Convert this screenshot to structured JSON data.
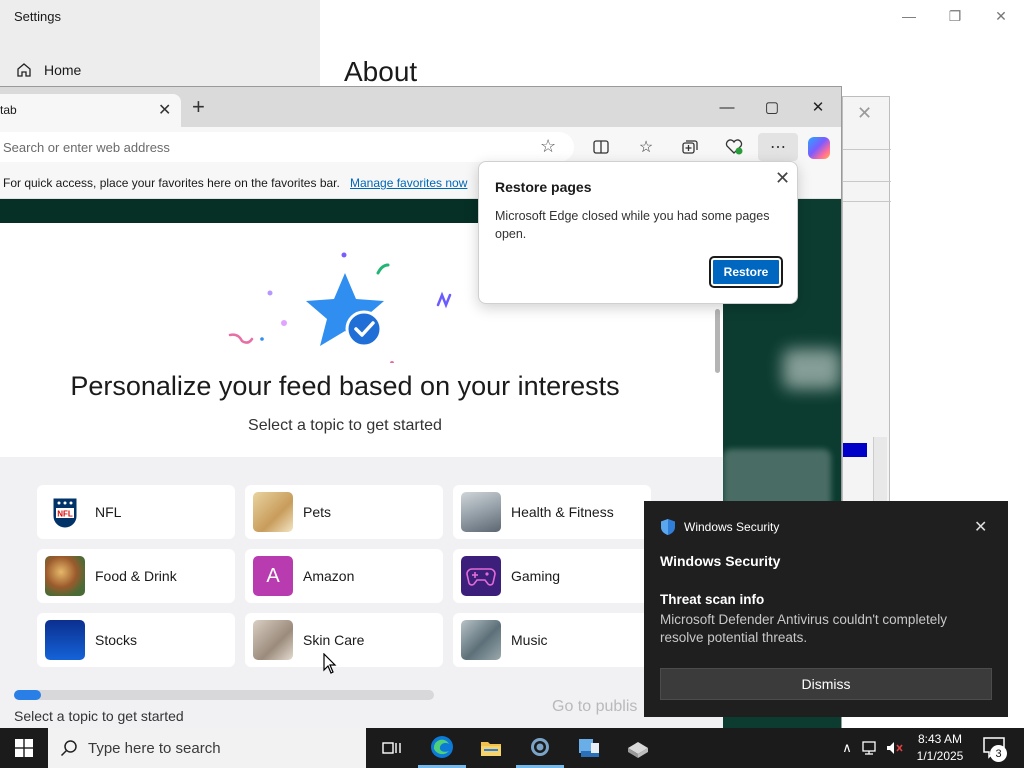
{
  "settings": {
    "title": "Settings",
    "home": "Home",
    "page_title": "About"
  },
  "edge": {
    "tab_title": "tab",
    "address_placeholder": "Search or enter web address",
    "favorites_message": "For quick access, place your favorites here on the favorites bar.",
    "favorites_link": "Manage favorites now"
  },
  "feed": {
    "headline": "Personalize your feed based on your interests",
    "subheadline": "Select a topic to get started",
    "topics": [
      "NFL",
      "Pets",
      "Health & Fitness",
      "Food & Drink",
      "Amazon",
      "Gaming",
      "Stocks",
      "Skin Care",
      "Music"
    ],
    "amazon_letter": "A",
    "progress_fraction": 0.065,
    "footer_prompt": "Select a topic to get started",
    "go_to_publisher": "Go to publis"
  },
  "restore_popup": {
    "title": "Restore pages",
    "body": "Microsoft Edge closed while you had some pages open.",
    "button": "Restore"
  },
  "toast": {
    "app_name": "Windows Security",
    "heading": "Windows Security",
    "subtitle": "Threat scan info",
    "body": "Microsoft Defender Antivirus couldn't completely resolve potential threats.",
    "dismiss": "Dismiss"
  },
  "taskbar": {
    "search_placeholder": "Type here to search",
    "time": "8:43 AM",
    "date": "1/1/2025",
    "notification_count": "3"
  },
  "colors": {
    "accent": "#0067c0",
    "page_dark": "#0c3c30",
    "progress": "#2a7fe6",
    "toast_bg": "#1f1f1f"
  }
}
